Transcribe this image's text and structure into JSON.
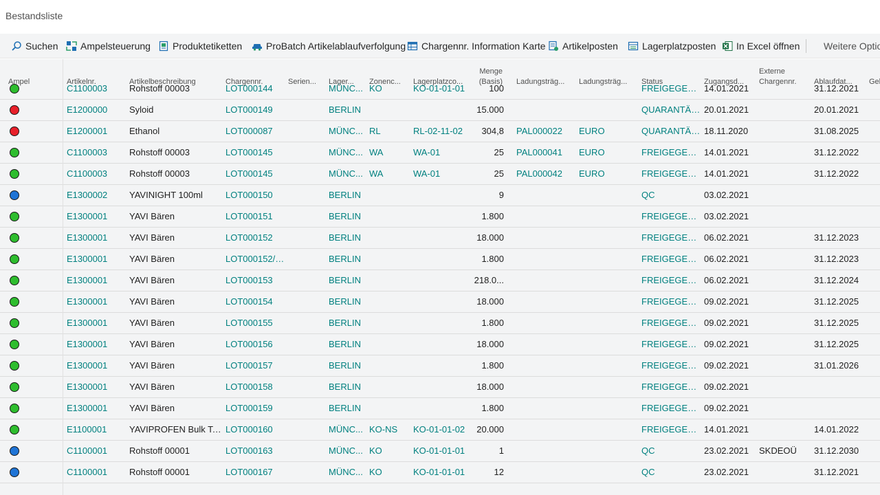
{
  "page": {
    "title": "Bestandsliste"
  },
  "toolbar": {
    "search": "Suchen",
    "ampel": "Ampelsteuerung",
    "produktetiketten": "Produktetiketten",
    "probatch": "ProBatch Artikelablaufverfolgung",
    "chargen_karte": "Chargennr. Information Karte",
    "artikelposten": "Artikelposten",
    "lagerplatzposten": "Lagerplatzposten",
    "excel": "In Excel öffnen",
    "more": "Weitere Optionen"
  },
  "colors": {
    "green": "#2ebd2e",
    "red": "#e8202a",
    "blue": "#1f74d6",
    "link": "#00807f"
  },
  "columns": {
    "ampel": "Ampel",
    "artikelnr": "Artikelnr.",
    "beschreibung": "Artikelbeschreibung",
    "chargennr": "Chargennr.",
    "serien": "Serien...",
    "lager": "Lager...",
    "zone": "Zonenc...",
    "lagerplatz": "Lagerplatzco...",
    "menge_1": "Menge",
    "menge_2": "(Basis)",
    "ladung1": "Ladungsträg...",
    "ladung2": "Ladungsträg...",
    "status": "Status",
    "zugang": "Zugangsd...",
    "extern_1": "Externe",
    "extern_2": "Chargennr.",
    "ablauf": "Ablaufdat...",
    "geb": "Geb"
  },
  "rows": [
    {
      "ampel": "green",
      "artikelnr": "C1100003",
      "beschreibung": "Rohstoff 00003",
      "chargennr": "LOT000144",
      "serien": "",
      "lager": "MÜNC...",
      "zone": "KO",
      "lagerplatz": "KO-01-01-01",
      "menge": "100",
      "ladung1": "",
      "ladung2": "",
      "status": "FREIGEGEBEN",
      "zugang": "14.01.2021",
      "extern": "",
      "ablauf": "31.12.2021"
    },
    {
      "ampel": "red",
      "artikelnr": "E1200000",
      "beschreibung": "Syloid",
      "chargennr": "LOT000149",
      "serien": "",
      "lager": "BERLIN",
      "zone": "",
      "lagerplatz": "",
      "menge": "15.000",
      "ladung1": "",
      "ladung2": "",
      "status": "QUARANTÄNE",
      "zugang": "20.01.2021",
      "extern": "",
      "ablauf": "20.01.2021"
    },
    {
      "ampel": "red",
      "artikelnr": "E1200001",
      "beschreibung": "Ethanol",
      "chargennr": "LOT000087",
      "serien": "",
      "lager": "MÜNC...",
      "zone": "RL",
      "lagerplatz": "RL-02-11-02",
      "menge": "304,8",
      "ladung1": "PAL000022",
      "ladung2": "EURO",
      "status": "QUARANTÄNE",
      "zugang": "18.11.2020",
      "extern": "",
      "ablauf": "31.08.2025"
    },
    {
      "ampel": "green",
      "artikelnr": "C1100003",
      "beschreibung": "Rohstoff 00003",
      "chargennr": "LOT000145",
      "serien": "",
      "lager": "MÜNC...",
      "zone": "WA",
      "lagerplatz": "WA-01",
      "menge": "25",
      "ladung1": "PAL000041",
      "ladung2": "EURO",
      "status": "FREIGEGEBEN",
      "zugang": "14.01.2021",
      "extern": "",
      "ablauf": "31.12.2022"
    },
    {
      "ampel": "green",
      "artikelnr": "C1100003",
      "beschreibung": "Rohstoff 00003",
      "chargennr": "LOT000145",
      "serien": "",
      "lager": "MÜNC...",
      "zone": "WA",
      "lagerplatz": "WA-01",
      "menge": "25",
      "ladung1": "PAL000042",
      "ladung2": "EURO",
      "status": "FREIGEGEBEN",
      "zugang": "14.01.2021",
      "extern": "",
      "ablauf": "31.12.2022"
    },
    {
      "ampel": "blue",
      "artikelnr": "E1300002",
      "beschreibung": "YAVINIGHT 100ml",
      "chargennr": "LOT000150",
      "serien": "",
      "lager": "BERLIN",
      "zone": "",
      "lagerplatz": "",
      "menge": "9",
      "ladung1": "",
      "ladung2": "",
      "status": "QC",
      "zugang": "03.02.2021",
      "extern": "",
      "ablauf": ""
    },
    {
      "ampel": "green",
      "artikelnr": "E1300001",
      "beschreibung": "YAVI Bären",
      "chargennr": "LOT000151",
      "serien": "",
      "lager": "BERLIN",
      "zone": "",
      "lagerplatz": "",
      "menge": "1.800",
      "ladung1": "",
      "ladung2": "",
      "status": "FREIGEGEBEN",
      "zugang": "03.02.2021",
      "extern": "",
      "ablauf": ""
    },
    {
      "ampel": "green",
      "artikelnr": "E1300001",
      "beschreibung": "YAVI Bären",
      "chargennr": "LOT000152",
      "serien": "",
      "lager": "BERLIN",
      "zone": "",
      "lagerplatz": "",
      "menge": "18.000",
      "ladung1": "",
      "ladung2": "",
      "status": "FREIGEGEBEN",
      "zugang": "06.02.2021",
      "extern": "",
      "ablauf": "31.12.2023"
    },
    {
      "ampel": "green",
      "artikelnr": "E1300001",
      "beschreibung": "YAVI Bären",
      "chargennr": "LOT000152/0...",
      "serien": "",
      "lager": "BERLIN",
      "zone": "",
      "lagerplatz": "",
      "menge": "1.800",
      "ladung1": "",
      "ladung2": "",
      "status": "FREIGEGEBEN",
      "zugang": "06.02.2021",
      "extern": "",
      "ablauf": "31.12.2023"
    },
    {
      "ampel": "green",
      "artikelnr": "E1300001",
      "beschreibung": "YAVI Bären",
      "chargennr": "LOT000153",
      "serien": "",
      "lager": "BERLIN",
      "zone": "",
      "lagerplatz": "",
      "menge": "218.0...",
      "ladung1": "",
      "ladung2": "",
      "status": "FREIGEGEBEN",
      "zugang": "06.02.2021",
      "extern": "",
      "ablauf": "31.12.2024"
    },
    {
      "ampel": "green",
      "artikelnr": "E1300001",
      "beschreibung": "YAVI Bären",
      "chargennr": "LOT000154",
      "serien": "",
      "lager": "BERLIN",
      "zone": "",
      "lagerplatz": "",
      "menge": "18.000",
      "ladung1": "",
      "ladung2": "",
      "status": "FREIGEGEBEN",
      "zugang": "09.02.2021",
      "extern": "",
      "ablauf": "31.12.2025"
    },
    {
      "ampel": "green",
      "artikelnr": "E1300001",
      "beschreibung": "YAVI Bären",
      "chargennr": "LOT000155",
      "serien": "",
      "lager": "BERLIN",
      "zone": "",
      "lagerplatz": "",
      "menge": "1.800",
      "ladung1": "",
      "ladung2": "",
      "status": "FREIGEGEBEN",
      "zugang": "09.02.2021",
      "extern": "",
      "ablauf": "31.12.2025"
    },
    {
      "ampel": "green",
      "artikelnr": "E1300001",
      "beschreibung": "YAVI Bären",
      "chargennr": "LOT000156",
      "serien": "",
      "lager": "BERLIN",
      "zone": "",
      "lagerplatz": "",
      "menge": "18.000",
      "ladung1": "",
      "ladung2": "",
      "status": "FREIGEGEBEN",
      "zugang": "09.02.2021",
      "extern": "",
      "ablauf": "31.12.2025"
    },
    {
      "ampel": "green",
      "artikelnr": "E1300001",
      "beschreibung": "YAVI Bären",
      "chargennr": "LOT000157",
      "serien": "",
      "lager": "BERLIN",
      "zone": "",
      "lagerplatz": "",
      "menge": "1.800",
      "ladung1": "",
      "ladung2": "",
      "status": "FREIGEGEBEN",
      "zugang": "09.02.2021",
      "extern": "",
      "ablauf": "31.01.2026"
    },
    {
      "ampel": "green",
      "artikelnr": "E1300001",
      "beschreibung": "YAVI Bären",
      "chargennr": "LOT000158",
      "serien": "",
      "lager": "BERLIN",
      "zone": "",
      "lagerplatz": "",
      "menge": "18.000",
      "ladung1": "",
      "ladung2": "",
      "status": "FREIGEGEBEN",
      "zugang": "09.02.2021",
      "extern": "",
      "ablauf": ""
    },
    {
      "ampel": "green",
      "artikelnr": "E1300001",
      "beschreibung": "YAVI Bären",
      "chargennr": "LOT000159",
      "serien": "",
      "lager": "BERLIN",
      "zone": "",
      "lagerplatz": "",
      "menge": "1.800",
      "ladung1": "",
      "ladung2": "",
      "status": "FREIGEGEBEN",
      "zugang": "09.02.2021",
      "extern": "",
      "ablauf": ""
    },
    {
      "ampel": "green",
      "artikelnr": "E1100001",
      "beschreibung": "YAVIPROFEN Bulk Tabl...",
      "chargennr": "LOT000160",
      "serien": "",
      "lager": "MÜNC...",
      "zone": "KO-NS",
      "lagerplatz": "KO-01-01-02",
      "menge": "20.000",
      "ladung1": "",
      "ladung2": "",
      "status": "FREIGEGEBEN",
      "zugang": "14.01.2021",
      "extern": "",
      "ablauf": "14.01.2022"
    },
    {
      "ampel": "blue",
      "artikelnr": "C1100001",
      "beschreibung": "Rohstoff 00001",
      "chargennr": "LOT000163",
      "serien": "",
      "lager": "MÜNC...",
      "zone": "KO",
      "lagerplatz": "KO-01-01-01",
      "menge": "1",
      "ladung1": "",
      "ladung2": "",
      "status": "QC",
      "zugang": "23.02.2021",
      "extern": "SKDEOÜ",
      "ablauf": "31.12.2030"
    },
    {
      "ampel": "blue",
      "artikelnr": "C1100001",
      "beschreibung": "Rohstoff 00001",
      "chargennr": "LOT000167",
      "serien": "",
      "lager": "MÜNC...",
      "zone": "KO",
      "lagerplatz": "KO-01-01-01",
      "menge": "12",
      "ladung1": "",
      "ladung2": "",
      "status": "QC",
      "zugang": "23.02.2021",
      "extern": "",
      "ablauf": "31.12.2021"
    }
  ]
}
